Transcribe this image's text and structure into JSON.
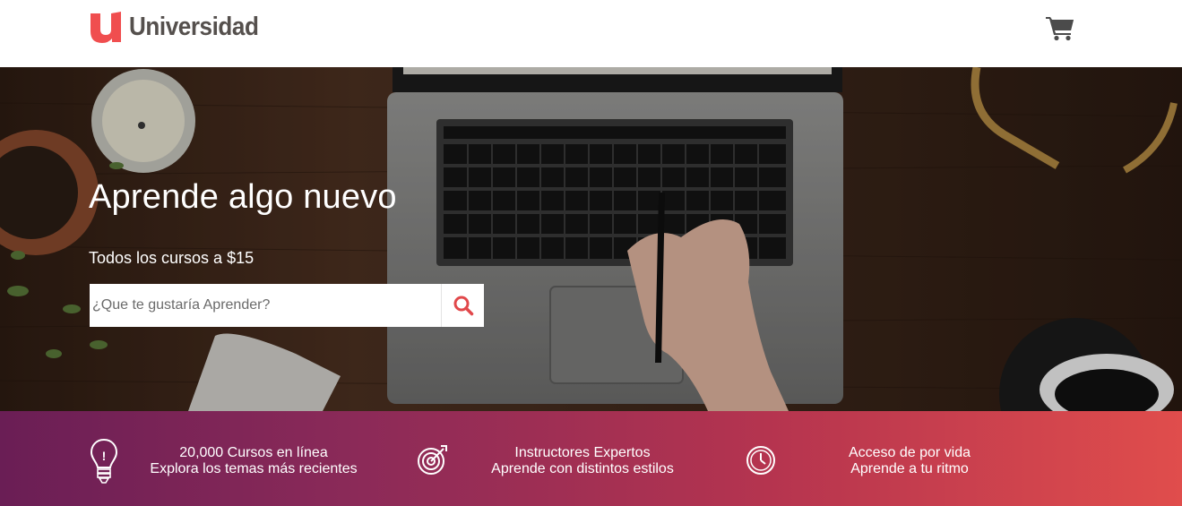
{
  "header": {
    "logo_letter": "u",
    "logo_text": "Universidad",
    "cart_icon": "shopping-cart-icon",
    "colors": {
      "logo_red": "#f04e4f",
      "logo_text": "#55504d",
      "cart": "#4b4b4b"
    }
  },
  "hero": {
    "title": "Aprende algo nuevo",
    "subtitle": "Todos los cursos a $15",
    "search": {
      "placeholder": "¿Que te gustaría Aprender?",
      "value": "",
      "button_icon": "search-icon",
      "icon_color": "#e1484b"
    }
  },
  "features": [
    {
      "icon": "lightbulb-icon",
      "title": "20,000 Cursos en línea",
      "text": "Explora los temas más recientes"
    },
    {
      "icon": "target-icon",
      "title": "Instructores Expertos",
      "text": "Aprende con distintos estilos"
    },
    {
      "icon": "clock-icon",
      "title": "Acceso de por vida",
      "text": "Aprende a tu ritmo"
    }
  ],
  "band_colors": {
    "start": "#6a1e55",
    "end": "#e04d4c"
  }
}
